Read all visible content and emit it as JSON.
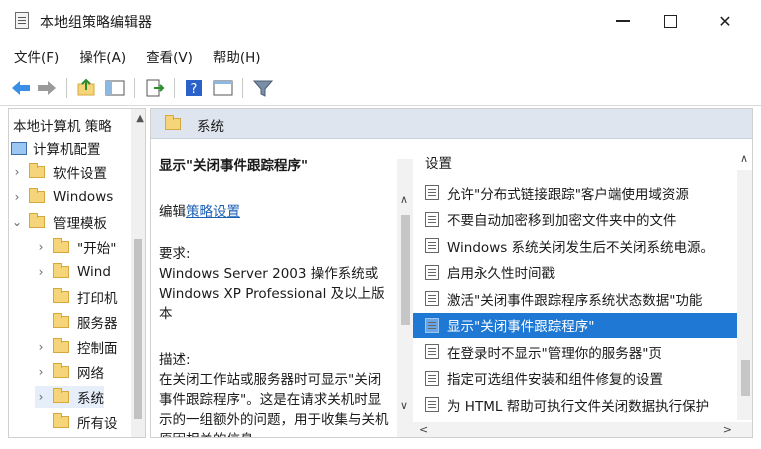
{
  "window": {
    "title": "本地组策略编辑器",
    "min_glyph": "—",
    "max_glyph": "□",
    "close_glyph": "✕"
  },
  "menu": [
    "文件(F)",
    "操作(A)",
    "查看(V)",
    "帮助(H)"
  ],
  "tree": {
    "root": "本地计算机 策略",
    "nodes": [
      {
        "label": "计算机配置",
        "level": 0,
        "chev": ""
      },
      {
        "label": "软件设置",
        "level": 1,
        "chev": "›"
      },
      {
        "label": "Windows",
        "level": 1,
        "chev": "›"
      },
      {
        "label": "管理模板",
        "level": 1,
        "chev": "⌄"
      },
      {
        "label": "\"开始\"",
        "level": 2,
        "chev": "›"
      },
      {
        "label": "Wind",
        "level": 2,
        "chev": "›"
      },
      {
        "label": "打印机",
        "level": 2,
        "chev": ""
      },
      {
        "label": "服务器",
        "level": 2,
        "chev": ""
      },
      {
        "label": "控制面",
        "level": 2,
        "chev": "›"
      },
      {
        "label": "网络",
        "level": 2,
        "chev": "›"
      },
      {
        "label": "系统",
        "level": 2,
        "chev": "›"
      },
      {
        "label": "所有设",
        "level": 2,
        "chev": ""
      }
    ]
  },
  "header": {
    "title": "系统"
  },
  "description": {
    "title": "显示\"关闭事件跟踪程序\"",
    "edit_prefix": "编辑",
    "edit_link": "策略设置",
    "req_label": "要求:",
    "req_text": "Windows Server 2003 操作系统或 Windows XP Professional 及以上版本",
    "desc_label": "描述:",
    "desc_text": "在关闭工作站或服务器时可显示\"关闭事件跟踪程序\"。这是在请求关机时显示的一组额外的问题，用于收集与关机原因相关的信息。"
  },
  "settings": {
    "header": "设置",
    "rows": [
      "允许\"分布式链接跟踪\"客户端使用域资源",
      "不要自动加密移到加密文件夹中的文件",
      "Windows 系统关闭发生后不关闭系统电源。",
      "启用永久性时间戳",
      "激活\"关闭事件跟踪程序系统状态数据\"功能",
      "显示\"关闭事件跟踪程序\"",
      "在登录时不显示\"管理你的服务器\"页",
      "指定可选组件安装和组件修复的设置",
      "为 HTML 帮助可执行文件关闭数据执行保护"
    ],
    "selected_index": 5
  },
  "colors": {
    "selection": "#1e78d4",
    "header_bg": "#dfe5ee",
    "link": "#1a5fb4"
  }
}
